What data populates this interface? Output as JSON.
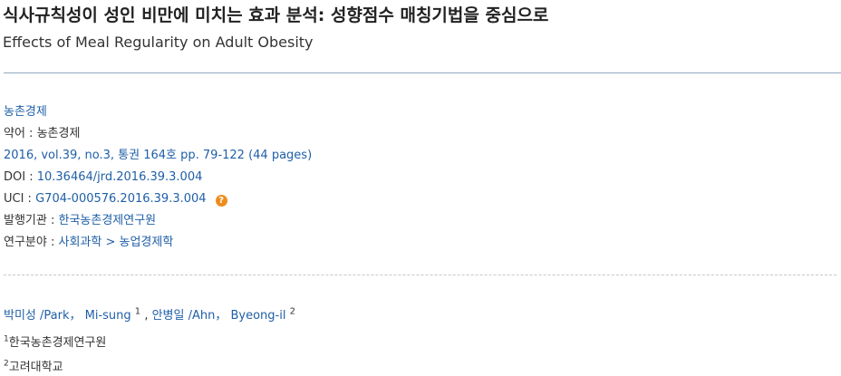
{
  "title_ko": "식사규칙성이 성인 비만에 미치는 효과 분석: 성향점수 매칭기법을 중심으로",
  "title_en": "Effects of Meal Regularity on Adult Obesity",
  "journal": {
    "name": "농촌경제",
    "abbr_label": "약어 :",
    "abbr_value": "농촌경제",
    "issue": "2016, vol.39, no.3, 통권 164호 pp. 79-122 (44 pages)",
    "doi_label": "DOI :",
    "doi_value": "10.36464/jrd.2016.39.3.004",
    "uci_label": "UCI :",
    "uci_value": "G704-000576.2016.39.3.004",
    "uci_help_icon": "question-circle-icon",
    "publisher_label": "발행기관 :",
    "publisher_value": "한국농촌경제연구원",
    "field_label": "연구분야 :",
    "field_value": "사회과학 > 농업경제학"
  },
  "authors": [
    {
      "name": "박미성 /Park，  Mi-sung",
      "sup": "1"
    },
    {
      "name": "안병일 /Ahn，  Byeong-il",
      "sup": "2"
    }
  ],
  "author_separator": ",",
  "affiliations": [
    {
      "sup": "1",
      "name": "한국농촌경제연구원"
    },
    {
      "sup": "2",
      "name": "고려대학교"
    }
  ],
  "colors": {
    "link": "#1f5fa7",
    "help_icon": "#ee8c1e",
    "divider": "#8fa9bd"
  }
}
